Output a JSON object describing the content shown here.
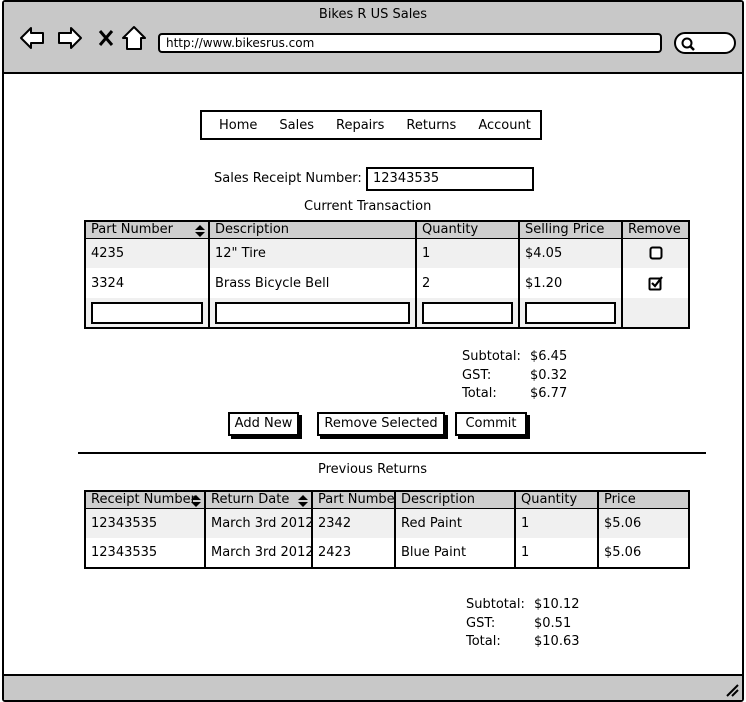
{
  "browser": {
    "title": "Bikes R US Sales",
    "url": "http://www.bikesrus.com"
  },
  "menu": [
    "Home",
    "Sales",
    "Repairs",
    "Returns",
    "Account"
  ],
  "receipt": {
    "label": "Sales Receipt Number:",
    "value": "12343535"
  },
  "current": {
    "title": "Current Transaction",
    "headers": [
      "Part Number",
      "Description",
      "Quantity",
      "Selling Price",
      "Remove"
    ],
    "rows": [
      {
        "part": "4235",
        "description": "12\" Tire",
        "quantity": "1",
        "price": "$4.05",
        "remove": false
      },
      {
        "part": "3324",
        "description": "Brass Bicycle Bell",
        "quantity": "2",
        "price": "$1.20",
        "remove": true
      }
    ],
    "totals": {
      "subtotal_label": "Subtotal:",
      "subtotal": "$6.45",
      "gst_label": "GST:",
      "gst": "$0.32",
      "total_label": "Total:",
      "total": "$6.77"
    }
  },
  "buttons": {
    "add_new": "Add New",
    "remove_selected": "Remove Selected",
    "commit": "Commit"
  },
  "previous": {
    "title": "Previous Returns",
    "headers": [
      "Receipt Number",
      "Return Date",
      "Part Number",
      "Description",
      "Quantity",
      "Price"
    ],
    "rows": [
      {
        "receipt": "12343535",
        "date": "March 3rd 2012",
        "part": "2342",
        "description": "Red Paint",
        "quantity": "1",
        "price": "$5.06"
      },
      {
        "receipt": "12343535",
        "date": "March 3rd 2012",
        "part": "2423",
        "description": "Blue Paint",
        "quantity": "1",
        "price": "$5.06"
      }
    ],
    "totals": {
      "subtotal_label": "Subtotal:",
      "subtotal": "$10.12",
      "gst_label": "GST:",
      "gst": "$0.51",
      "total_label": "Total:",
      "total": "$10.63"
    }
  }
}
